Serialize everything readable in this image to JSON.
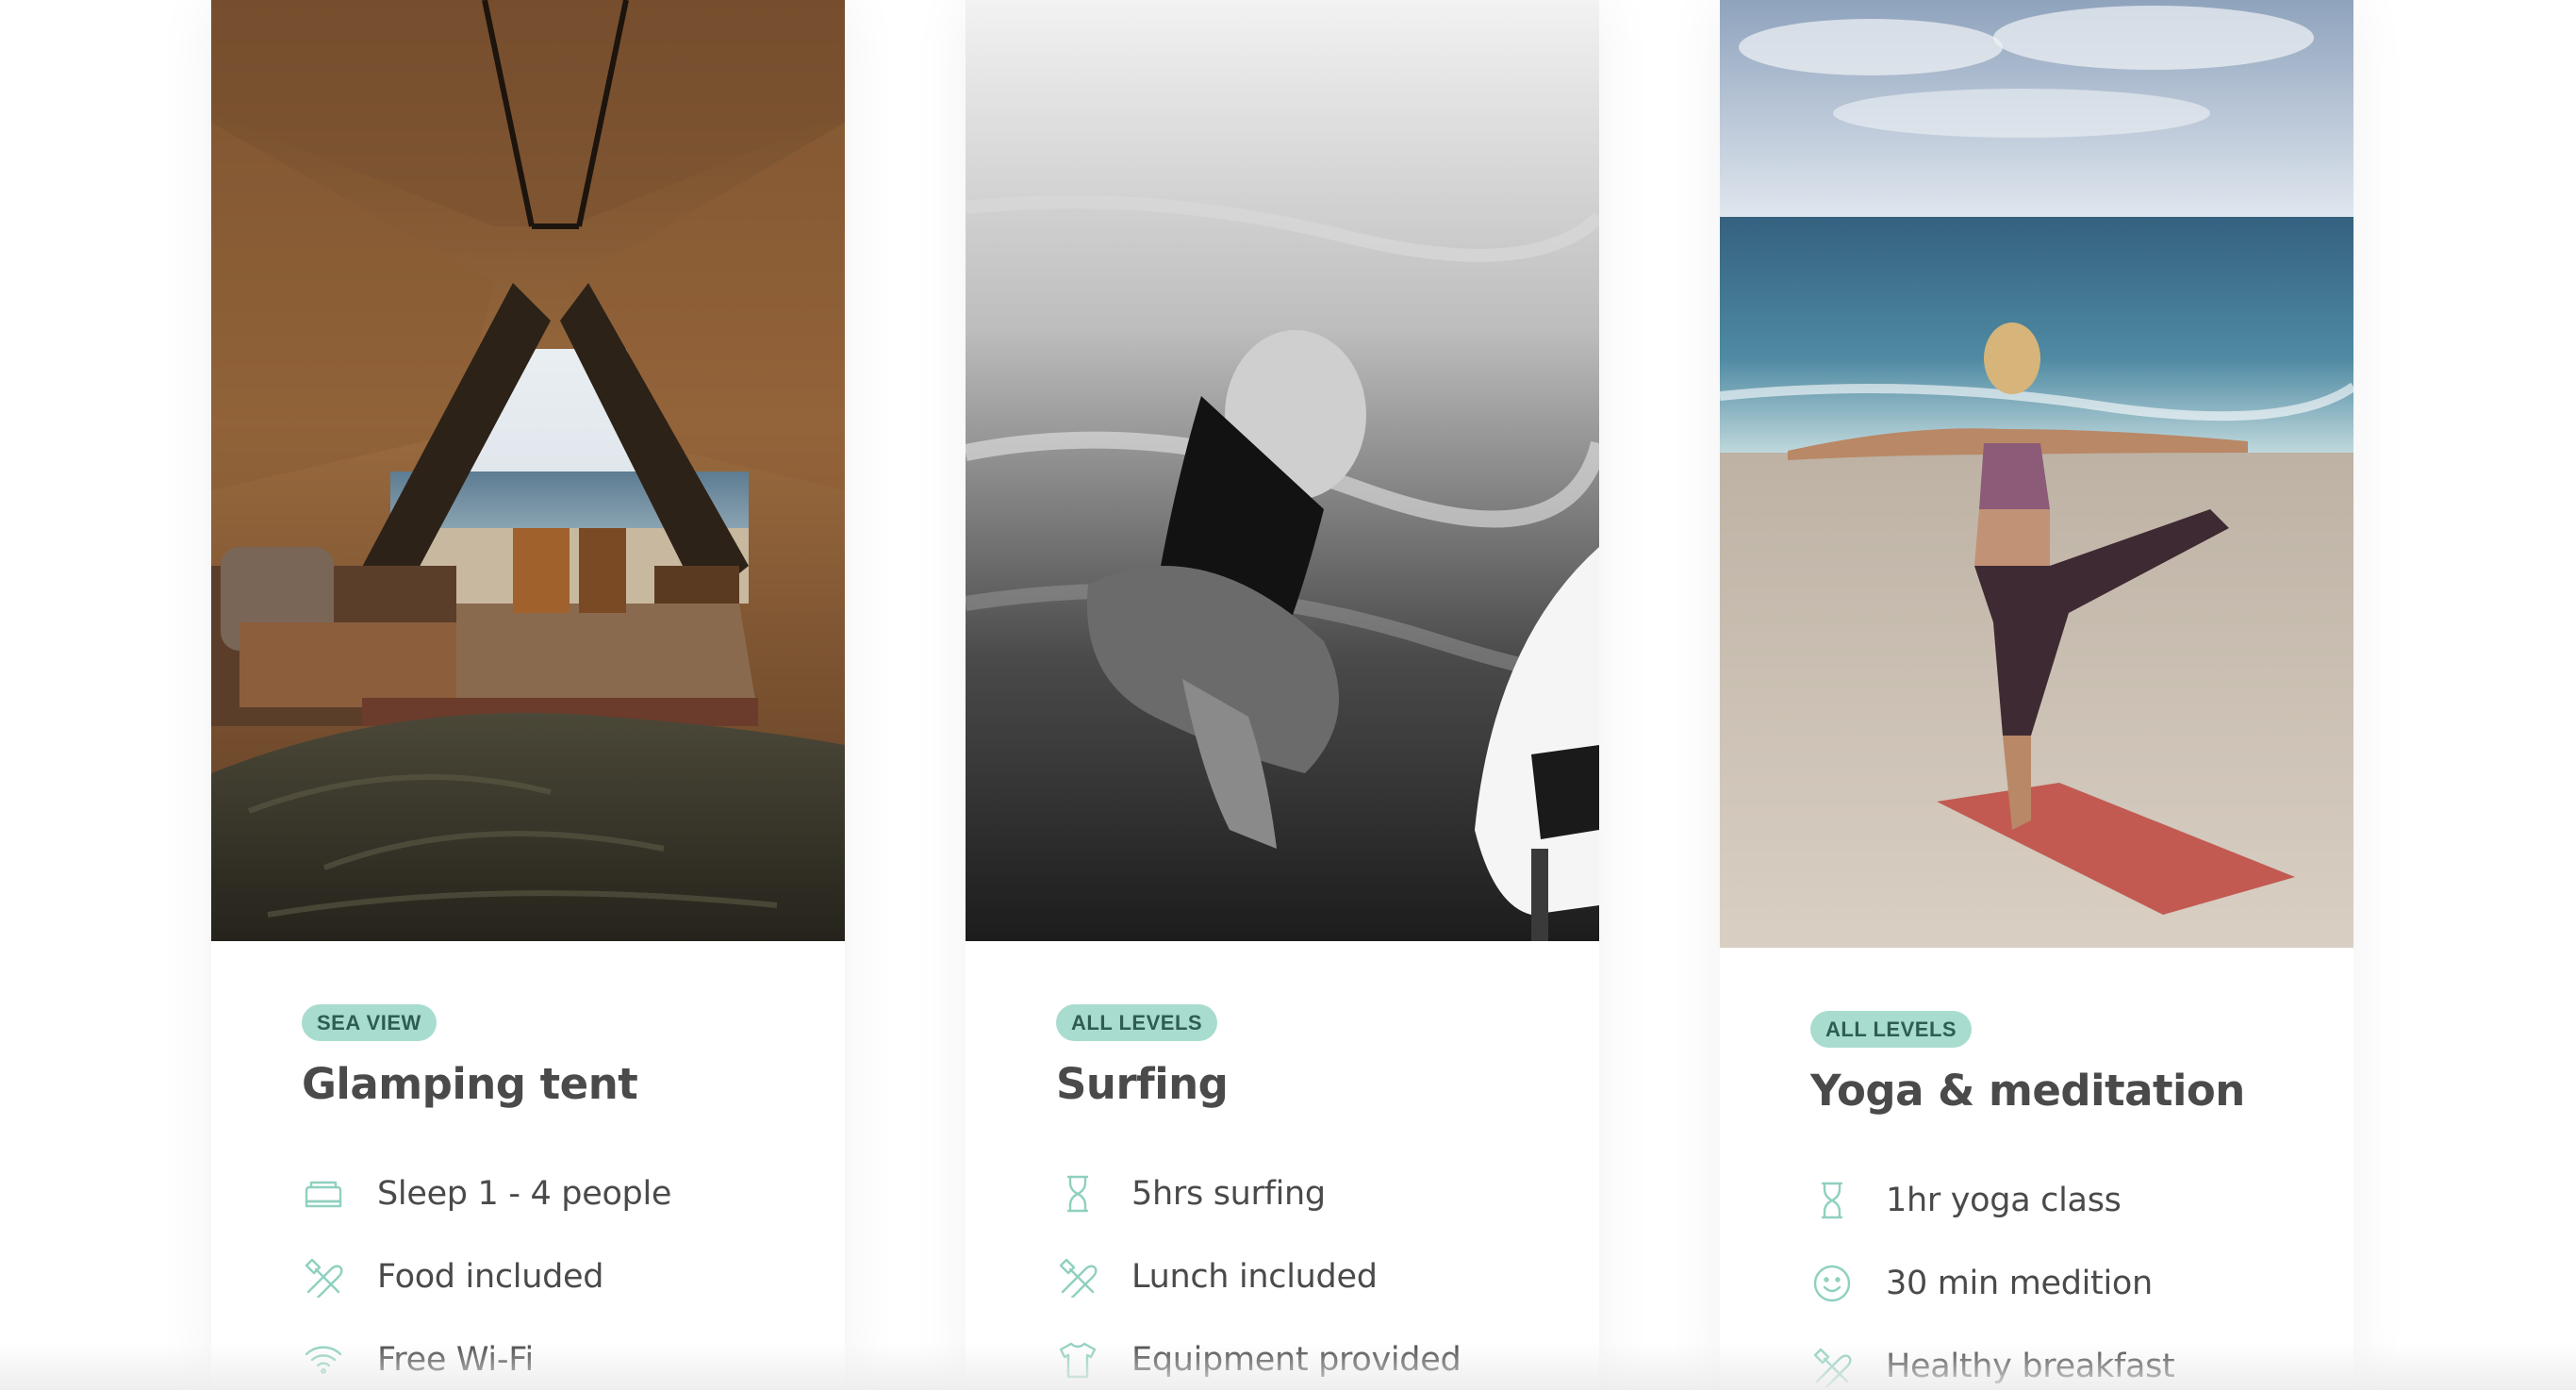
{
  "cards": [
    {
      "badge": "SEA VIEW",
      "title": "Glamping tent",
      "image": "glamping-tent-photo",
      "features": [
        {
          "icon": "bed-icon",
          "label": "Sleep 1 - 4 people"
        },
        {
          "icon": "fork-knife-icon",
          "label": "Food included"
        },
        {
          "icon": "wifi-icon",
          "label": "Free Wi-Fi"
        }
      ]
    },
    {
      "badge": "ALL LEVELS",
      "title": "Surfing",
      "image": "surfing-photo",
      "features": [
        {
          "icon": "hourglass-icon",
          "label": "5hrs surfing"
        },
        {
          "icon": "fork-knife-icon",
          "label": "Lunch included"
        },
        {
          "icon": "tshirt-icon",
          "label": "Equipment provided"
        }
      ]
    },
    {
      "badge": "ALL LEVELS",
      "title": "Yoga & meditation",
      "image": "yoga-photo",
      "features": [
        {
          "icon": "hourglass-icon",
          "label": "1hr yoga class"
        },
        {
          "icon": "smiley-icon",
          "label": "30 min medition"
        },
        {
          "icon": "fork-knife-icon",
          "label": "Healthy breakfast"
        }
      ]
    }
  ],
  "colors": {
    "badge_bg": "#a8dccf",
    "badge_text": "#2f5d52",
    "icon": "#8fd0bf",
    "text": "#4a4a4a"
  }
}
